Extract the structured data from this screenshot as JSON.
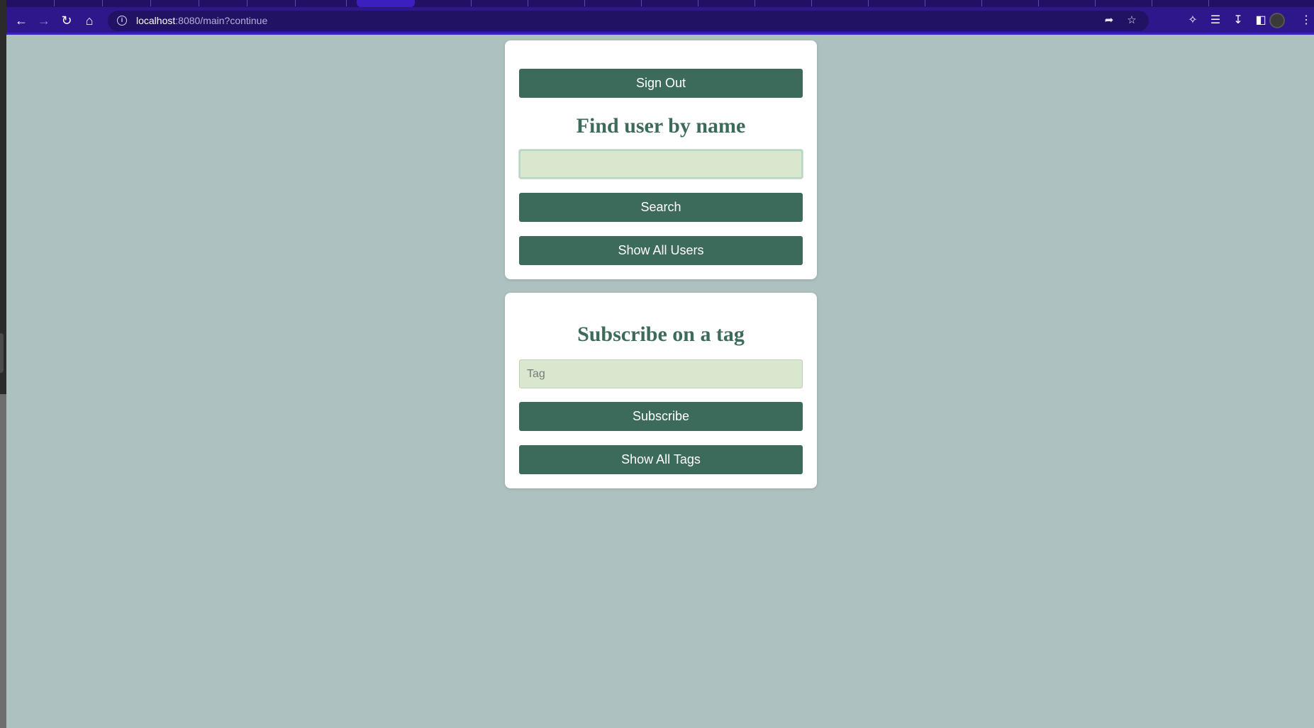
{
  "browser": {
    "url_host": "localhost",
    "url_rest": ":8080/main?continue",
    "icons": {
      "back": "arrow-left-icon",
      "forward": "arrow-right-icon",
      "reload": "reload-icon",
      "home": "home-icon",
      "info": "info-icon",
      "share": "share-icon",
      "bookmark": "star-icon",
      "extensions": "puzzle-icon",
      "media": "media-queue-icon",
      "downloads": "download-icon",
      "sidepanel": "side-panel-icon",
      "profile": "avatar",
      "menu": "kebab-menu-icon"
    }
  },
  "find_user": {
    "sign_out_label": "Sign Out",
    "heading": "Find user by name",
    "search_value": "",
    "search_placeholder": "",
    "search_label": "Search",
    "show_all_label": "Show All Users"
  },
  "subscribe": {
    "heading": "Subscribe on a tag",
    "tag_value": "",
    "tag_placeholder": "Tag",
    "subscribe_label": "Subscribe",
    "show_all_label": "Show All Tags"
  },
  "colors": {
    "page_bg": "#adc1c0",
    "button_bg": "#3d6b5b",
    "heading": "#3d6b5b",
    "input_bg": "#d9e7cf",
    "card_bg": "#ffffff",
    "browser_frame": "#2e178a"
  }
}
